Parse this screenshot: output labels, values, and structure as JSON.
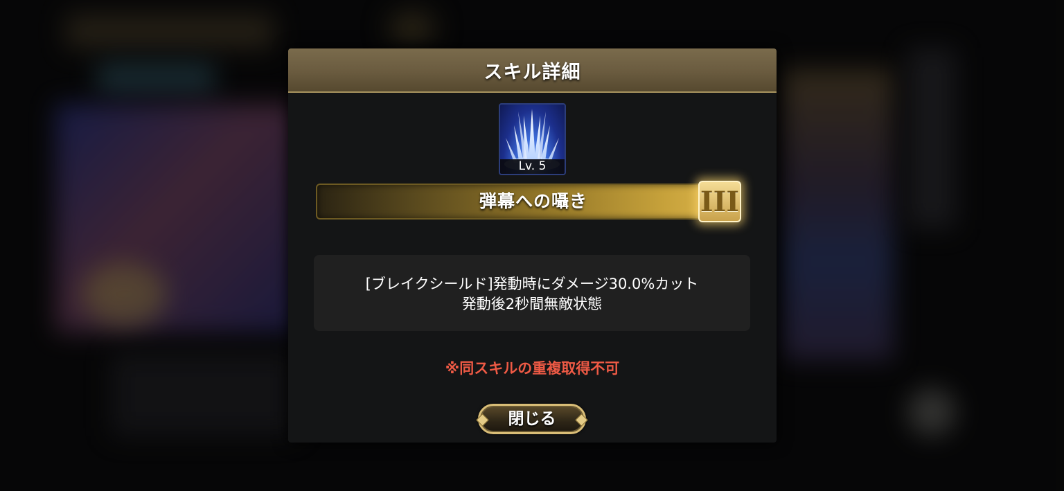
{
  "dialog": {
    "title": "スキル詳細",
    "skill": {
      "icon": "ice-spikes-skill-icon",
      "level_label": "Lv. 5",
      "name": "弾幕への囁き",
      "rank": "III"
    },
    "description": {
      "line1": "[ブレイクシールド]発動時にダメージ30.0%カット",
      "line2": "発動後2秒間無敵状態"
    },
    "warning": "※同スキルの重複取得不可",
    "close_label": "閉じる"
  },
  "colors": {
    "header_gold": "#7a6b4c",
    "warning_red": "#ef5a45",
    "rank_gold": "#f4dc96",
    "panel_bg": "#141516"
  }
}
